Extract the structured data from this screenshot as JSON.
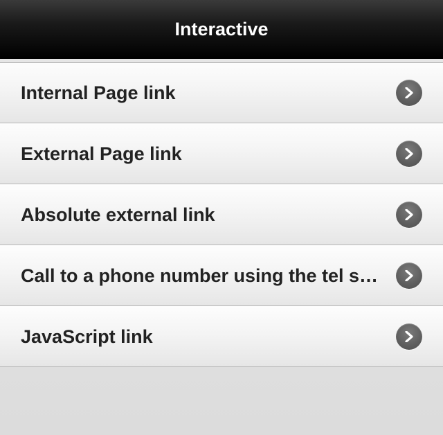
{
  "header": {
    "title": "Interactive"
  },
  "list": {
    "items": [
      {
        "label": "Internal Page link"
      },
      {
        "label": "External Page link"
      },
      {
        "label": "Absolute external link"
      },
      {
        "label": "Call to a phone number using the tel scheme"
      },
      {
        "label": "JavaScript link"
      }
    ]
  }
}
